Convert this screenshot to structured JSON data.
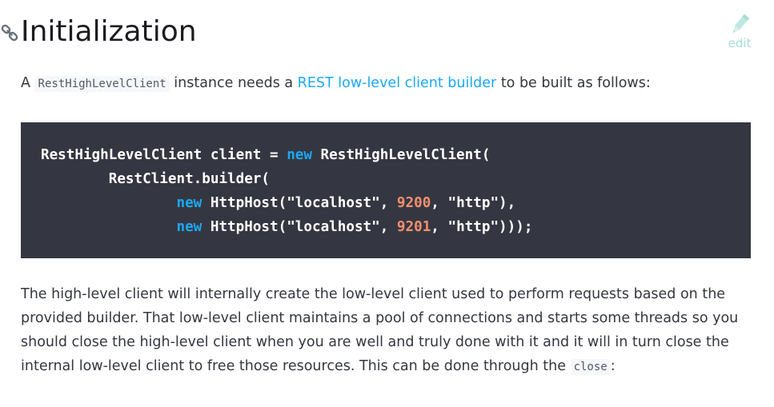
{
  "section": {
    "title": "Initialization",
    "edit_label": "edit"
  },
  "intro": {
    "prefix": "A ",
    "code_term": "RestHighLevelClient",
    "middle": " instance needs a ",
    "link_text": "REST low-level client builder",
    "suffix": " to be built as follows:"
  },
  "code": {
    "line1_a": "RestHighLevelClient client = ",
    "line1_kw": "new",
    "line1_b": " RestHighLevelClient(",
    "line2": "        RestClient.builder(",
    "line3_indent": "                ",
    "line3_kw": "new",
    "line3_a": " HttpHost(",
    "line3_str1": "\"localhost\"",
    "line3_sep1": ", ",
    "line3_num": "9200",
    "line3_sep2": ", ",
    "line3_str2": "\"http\"",
    "line3_end": "),",
    "line4_indent": "                ",
    "line4_kw": "new",
    "line4_a": " HttpHost(",
    "line4_str1": "\"localhost\"",
    "line4_sep1": ", ",
    "line4_num": "9201",
    "line4_sep2": ", ",
    "line4_str2": "\"http\"",
    "line4_end": ")));"
  },
  "body": {
    "text": "The high-level client will internally create the low-level client used to perform requests based on the provided builder. That low-level client maintains a pool of connections and starts some threads so you should close the high-level client when you are well and truly done with it and it will in turn close the internal low-level client to free those resources. This can be done through the ",
    "code_term": "close",
    "suffix": ":"
  },
  "colors": {
    "link": "#1ba9f5",
    "code_bg": "#343741",
    "keyword": "#1ba9f5",
    "number": "#f58f6e",
    "edit": "#a6dfd6"
  },
  "icons": {
    "anchor": "link-chain-icon",
    "edit": "pencil-icon"
  }
}
